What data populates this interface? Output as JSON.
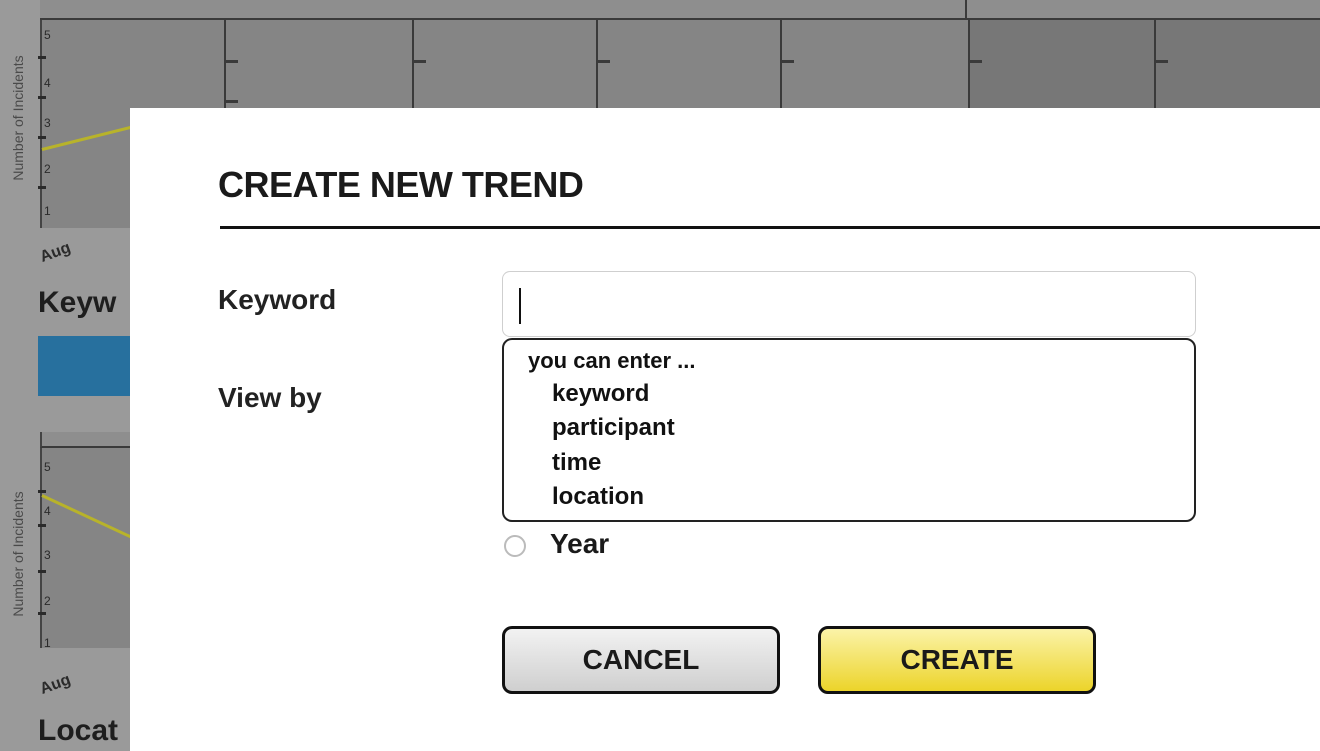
{
  "background": {
    "chart1": {
      "y_axis_label": "Number of Incidents",
      "y_ticks": [
        "5",
        "4",
        "3",
        "2",
        "1"
      ],
      "x_start": "Aug"
    },
    "section1_heading": "Keyw",
    "chart2": {
      "y_axis_label": "Number of Incidents",
      "y_ticks": [
        "5",
        "4",
        "3",
        "2",
        "1"
      ],
      "x_start": "Aug"
    },
    "section2_heading": "Locat"
  },
  "dialog": {
    "title": "CREATE NEW TREND",
    "keyword_label": "Keyword",
    "keyword_value": "",
    "view_by_label": "View by",
    "suggestions": {
      "heading": "you can enter ...",
      "items": [
        "keyword",
        "participant",
        "time",
        "location"
      ]
    },
    "view_by_option": "Year",
    "cancel_label": "CANCEL",
    "create_label": "CREATE"
  },
  "colors": {
    "create_button": "#ecd42a",
    "trend_line": "#b8b32a",
    "accent_blue": "#27709e"
  }
}
